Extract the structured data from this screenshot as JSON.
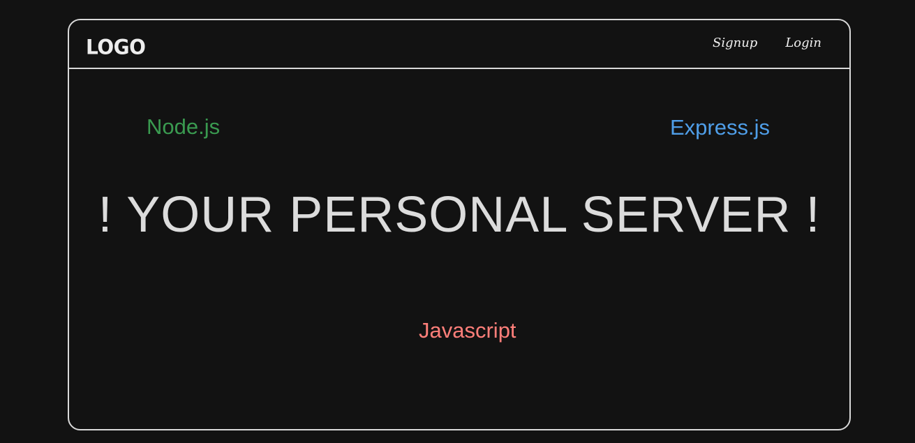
{
  "navbar": {
    "logo": "LOGO",
    "links": [
      {
        "label": "Signup"
      },
      {
        "label": "Login"
      }
    ]
  },
  "hero": {
    "headline": "! YOUR PERSONAL SERVER !",
    "tags": {
      "node": "Node.js",
      "express": "Express.js",
      "javascript": "Javascript"
    }
  },
  "colors": {
    "background": "#121212",
    "frame": "#d9d9d9",
    "node": "#3a9a50",
    "express": "#4f9ee8",
    "javascript": "#ff7f7a"
  }
}
